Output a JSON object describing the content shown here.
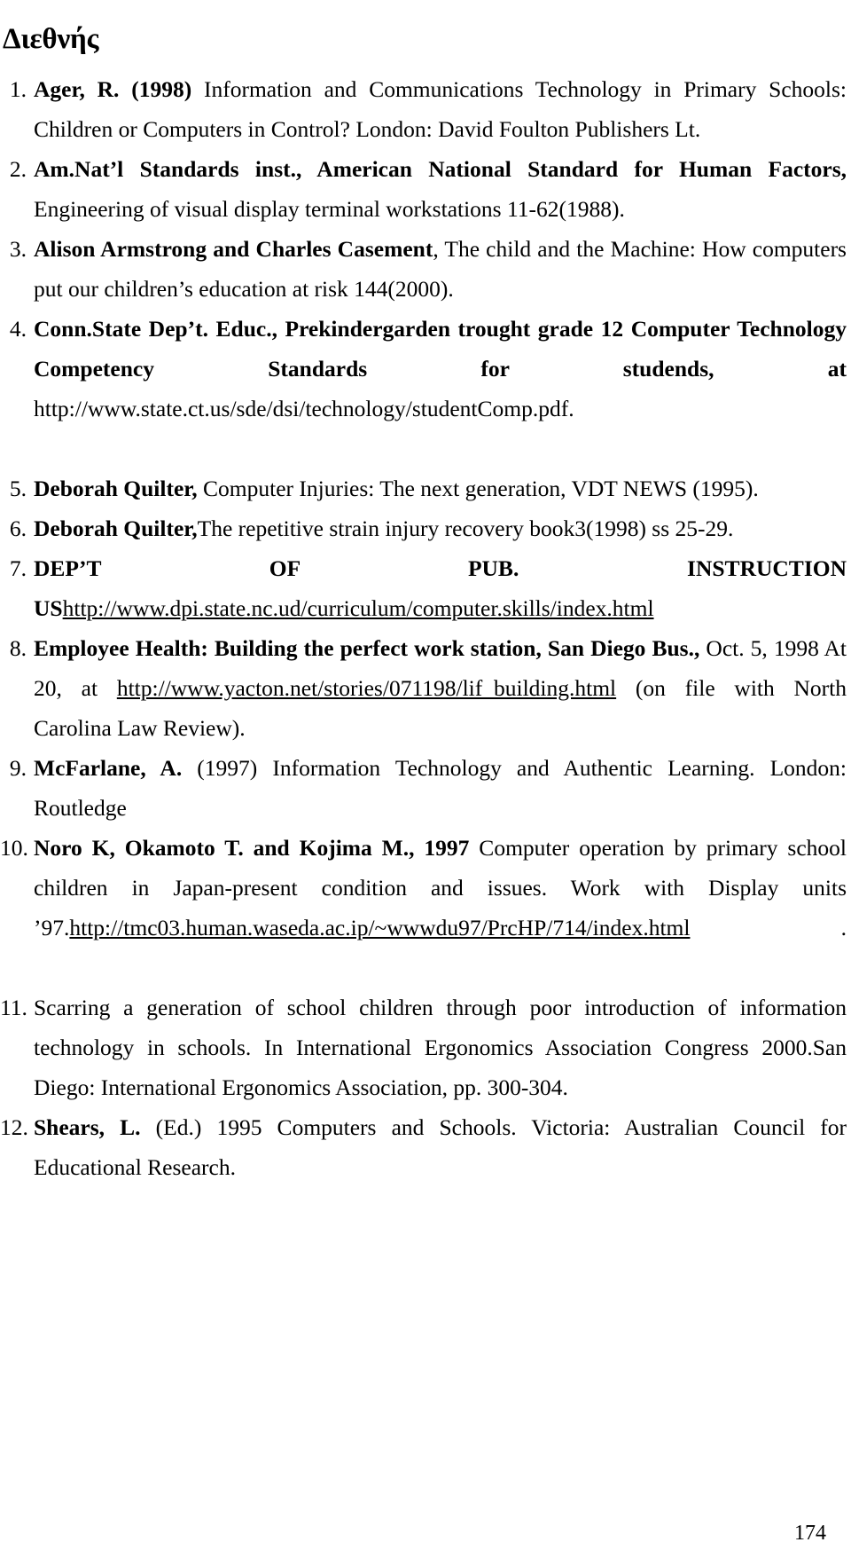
{
  "document": {
    "title": "Διεθνής",
    "page_number": "174"
  },
  "references": [
    {
      "number": "1.",
      "bold_lead": "Ager, R. (1998)",
      "rest": " Information and Communications Technology in Primary Schools: Children or Computers in Control? London: David Foulton Publishers Lt.",
      "justify_last": false
    },
    {
      "number": "2.",
      "bold_lead": "Am.Nat’l Standards inst., American National Standard for Human Factors,",
      "rest": " Engineering of visual display terminal workstations 11-62(1988).",
      "justify_last": false
    },
    {
      "number": "3.",
      "bold_lead": "Alison Armstrong and Charles Casement",
      "rest": ", The child and the Machine: How computers put our children’s education at risk 144(2000).",
      "justify_last": false
    },
    {
      "number": "4.",
      "bold_lead": "Conn.State Dep’t. Educ., Prekindergarden trought grade 12 Computer Technology Competency Standards for studends, at",
      "rest": " ",
      "url": "http://www.state.ct.us/sde/dsi/technology/studentComp.pdf.",
      "url_underlined": false,
      "justify_last": true
    },
    {
      "number": "5.",
      "bold_lead": "Deborah Quilter,",
      "rest": " Computer Injuries: The next generation, VDT NEWS (1995).",
      "justify_last": false
    },
    {
      "number": "6.",
      "bold_lead": "Deborah Quilter,",
      "rest": "The repetitive strain injury recovery book3(1998) ss 25-29.",
      "justify_last": false
    },
    {
      "number": "7.",
      "bold_lead": "DEP’T OF PUB. INSTRUCTION US",
      "rest": "",
      "url": "http://www.dpi.state.nc.ud/curriculum/computer.skills/index.html",
      "url_underlined": true,
      "justify_last": false
    },
    {
      "number": "8.",
      "bold_lead": "Employee Health: Building the perfect work station, San Diego Bus.,",
      "rest": " Oct. 5, 1998 At 20, at ",
      "url": "http://www.yacton.net/stories/071198/lif_building.html",
      "url_underlined": true,
      "tail": " (on file with North Carolina Law Review).",
      "justify_last": false
    },
    {
      "number": "9.",
      "bold_lead": "McFarlane, A.",
      "rest": " (1997) Information Technology and Authentic Learning. London: Routledge",
      "justify_last": false
    },
    {
      "number": "10.",
      "bold_lead": "Noro K, Okamoto T. and Kojima M., 1997",
      "rest": " Computer operation by primary school children in Japan-present condition and issues. Work with Display units ’97.",
      "url": "http://tmc03.human.waseda.ac.ip/~wwwdu97/PrcHP/714/index.html",
      "url_underlined": true,
      "tail": " .",
      "justify_last": true
    },
    {
      "number": "11.",
      "bold_lead": "",
      "rest": "Scarring a generation of school children through poor introduction of information technology in schools. In International Ergonomics Association Congress 2000.San Diego: International Ergonomics Association, pp. 300-304.",
      "justify_last": false
    },
    {
      "number": "12.",
      "bold_lead": "Shears, L.",
      "rest": " (Ed.) 1995 Computers and Schools. Victoria: Australian Council for Educational Research.",
      "justify_last": false
    }
  ]
}
